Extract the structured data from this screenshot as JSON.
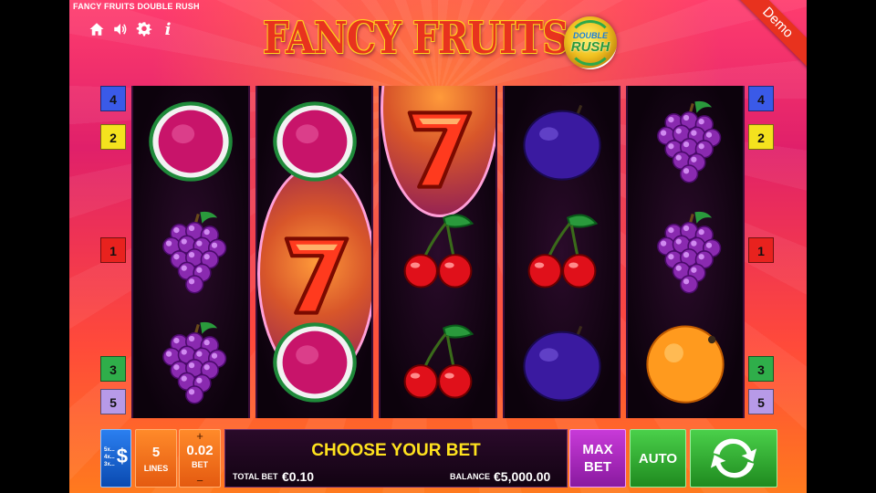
{
  "header": {
    "game_title": "FANCY FRUITS DOUBLE RUSH",
    "logo_main": "FANCY FRUITS",
    "logo_badge_top": "DOUBLE",
    "logo_badge_bottom": "RUSH",
    "demo_label": "Demo"
  },
  "top_icons": [
    "home-icon",
    "speaker-icon",
    "gear-icon",
    "info-icon"
  ],
  "info_glyph": "i",
  "paylines": {
    "left": [
      {
        "label": "4",
        "color": "#3a5ae8"
      },
      {
        "label": "2",
        "color": "#f4e21e"
      },
      {
        "label": "1",
        "color": "#e8221e"
      },
      {
        "label": "3",
        "color": "#2fae4a"
      },
      {
        "label": "5",
        "color": "#b79ae8"
      }
    ],
    "right": [
      {
        "label": "4",
        "color": "#3a5ae8"
      },
      {
        "label": "2",
        "color": "#f4e21e"
      },
      {
        "label": "1",
        "color": "#e8221e"
      },
      {
        "label": "3",
        "color": "#2fae4a"
      },
      {
        "label": "5",
        "color": "#b79ae8"
      }
    ]
  },
  "reels": [
    [
      "watermelon",
      "grapes",
      "grapes"
    ],
    [
      "watermelon",
      "seven",
      "watermelon"
    ],
    [
      "seven",
      "cherries",
      "cherries"
    ],
    [
      "plum",
      "cherries",
      "plum"
    ],
    [
      "grapes",
      "grapes",
      "orange"
    ]
  ],
  "controls": {
    "paytable_lines": [
      "5x...",
      "4x...",
      "3x..."
    ],
    "paytable_symbol": "$",
    "lines_value": "5",
    "lines_label": "LINES",
    "bet_plus": "+",
    "bet_value": "0.02",
    "bet_label": "BET",
    "bet_minus": "−",
    "message": "CHOOSE YOUR BET",
    "total_bet_label": "TOTAL BET",
    "total_bet_value": "€0.10",
    "balance_label": "BALANCE",
    "balance_value": "€5,000.00",
    "maxbet_line1": "MAX",
    "maxbet_line2": "BET",
    "auto_label": "AUTO"
  },
  "colors": {
    "accent_yellow": "#ffe21e",
    "logo_red": "#e8321e",
    "spin_green": "#2fae4a"
  }
}
